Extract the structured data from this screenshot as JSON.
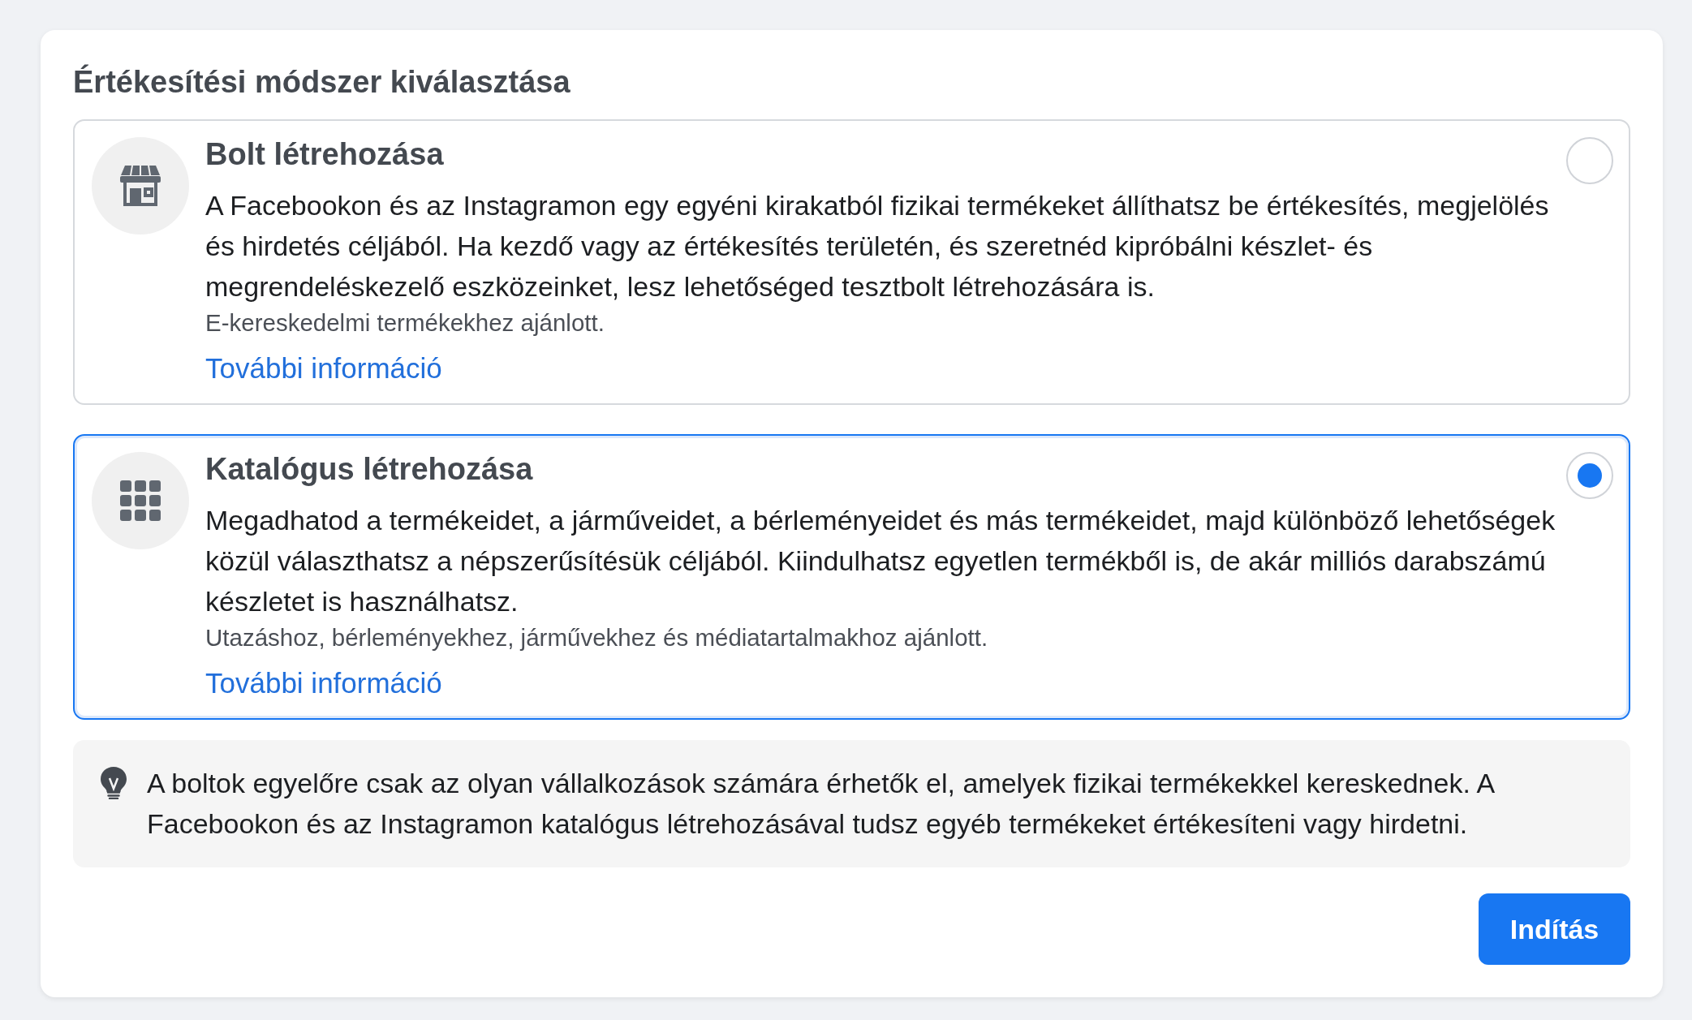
{
  "title": "Értékesítési módszer kiválasztása",
  "options": [
    {
      "kind": "shop",
      "title": "Bolt létrehozása",
      "description": "A Facebookon és az Instagramon egy egyéni kirakatból fizikai termékeket állíthatsz be értékesítés, megjelölés és hirdetés céljából. Ha kezdő vagy az értékesítés területén, és szeretnéd kipróbálni készlet- és megrendeléskezelő eszközeinket, lesz lehetőséged tesztbolt létrehozására is.",
      "note": "E-kereskedelmi termékekhez ajánlott.",
      "link": "További információ",
      "selected": false
    },
    {
      "kind": "catalog",
      "title": "Katalógus létrehozása",
      "description": "Megadhatod a termékeidet, a járműveidet, a bérleményeidet és más termékeidet, majd különböző lehetőségek közül választhatsz a népszerűsítésük céljából. Kiindulhatsz egyetlen termékből is, de akár milliós darabszámú készletet is használhatsz.",
      "note": "Utazáshoz, bérleményekhez, járművekhez és médiatartalmakhoz ajánlott.",
      "link": "További információ",
      "selected": true
    }
  ],
  "tip": {
    "text": "A boltok egyelőre csak az olyan vállalkozások számára érhetők el, amelyek fizikai termékekkel kereskednek. A Facebookon és az Instagramon katalógus létrehozásával tudsz egyéb termékeket értékesíteni vagy hirdetni."
  },
  "primary_button": {
    "label": "Indítás"
  }
}
